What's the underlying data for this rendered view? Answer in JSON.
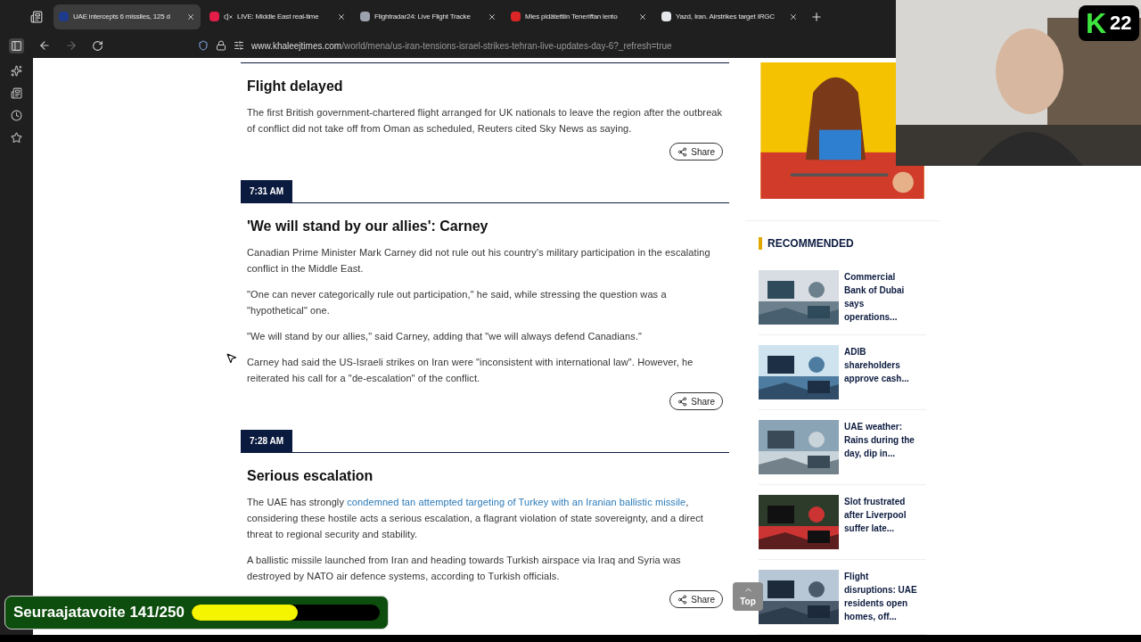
{
  "tabs": [
    {
      "title": "UAE intercepts 6 missiles, 125 d",
      "selected": true,
      "color": "#1e3a8a"
    },
    {
      "title": "LIVE: Middle East real-time",
      "selected": false,
      "color": "#e11d48"
    },
    {
      "title": "Flightradar24: Live Flight Tracke",
      "selected": false,
      "color": "#9ca3af"
    },
    {
      "title": "Mies pidätettiin Teneriffan lento",
      "selected": false,
      "color": "#dc2626"
    },
    {
      "title": "Yazd, Iran. Airstrikes target IRGC",
      "selected": false,
      "color": "#e5e7eb"
    }
  ],
  "address": {
    "domain": "www.khaleejtimes.com",
    "path": "/world/mena/us-iran-tensions-israel-strikes-tehran-live-updates-day-6?_refresh=true"
  },
  "entries": [
    {
      "title": "Flight delayed",
      "paragraphs": [
        [
          {
            "kind": "text",
            "text": "The first British government-chartered flight arranged for UK nationals to leave the region after the outbreak of conflict did not take off from Oman as scheduled, Reuters cited Sky News as saying."
          }
        ]
      ],
      "share": "Share"
    },
    {
      "time": "7:31 AM",
      "title": "'We will stand by our allies': Carney",
      "paragraphs": [
        [
          {
            "kind": "text",
            "text": "Canadian Prime Minister Mark Carney did not rule out his country's military participation in the escalating conflict in the Middle East."
          }
        ],
        [
          {
            "kind": "text",
            "text": "\"One can never categorically rule out participation,\" he said, while stressing the question was a \"hypothetical\" one."
          }
        ],
        [
          {
            "kind": "text",
            "text": "\"We will stand by our allies,\" said Carney, adding that \"we will always defend Canadians.\""
          }
        ],
        [
          {
            "kind": "text",
            "text": "Carney had said the US-Israeli strikes on Iran were \"inconsistent with international law\". However, he reiterated his call for a \"de-escalation\" of the conflict."
          }
        ]
      ],
      "share": "Share"
    },
    {
      "time": "7:28 AM",
      "title": "Serious escalation",
      "paragraphs": [
        [
          {
            "kind": "text",
            "text": "The UAE has strongly "
          },
          {
            "kind": "link",
            "text": "condemned tan attempted targeting of Turkey with an Iranian ballistic missile"
          },
          {
            "kind": "text",
            "text": ", considering these hostile acts a serious escalation, a flagrant violation of state sovereignty, and a direct threat to regional security and stability."
          }
        ],
        [
          {
            "kind": "text",
            "text": "A ballistic missile launched from Iran and heading towards Turkish airspace via Iraq and Syria was destroyed by NATO air defence systems, according to Turkish officials."
          }
        ]
      ],
      "share": "Share"
    }
  ],
  "top_button": "Top",
  "recommended": {
    "heading": "RECOMMENDED",
    "items": [
      {
        "title": "Commercial Bank of Dubai says operations..."
      },
      {
        "title": "ADIB shareholders approve cash..."
      },
      {
        "title": "UAE weather: Rains during the day, dip in..."
      },
      {
        "title": "Slot frustrated after Liverpool suffer late..."
      },
      {
        "title": "Flight disruptions: UAE residents open homes, off..."
      }
    ]
  },
  "stream": {
    "logo_letter": "K",
    "logo_number": "22",
    "goal_label": "Seuraajatavoite 141/250",
    "level": 0.564
  }
}
